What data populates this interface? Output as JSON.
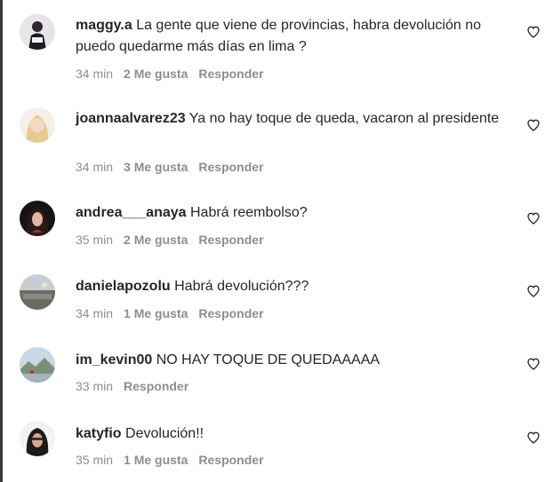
{
  "comments": [
    {
      "user": "maggy.a",
      "text": "La gente que viene de provincias, habra devolución no puedo quedarme más días en lima ?",
      "time": "34 min",
      "likes": "2 Me gusta",
      "reply": "Responder",
      "avatar_icon": "user-avatar"
    },
    {
      "user": "joannaalvarez23",
      "text": "Ya no hay toque de queda, vacaron al presidente",
      "time": "34 min",
      "likes": "3 Me gusta",
      "reply": "Responder",
      "avatar_icon": "user-avatar"
    },
    {
      "user": "andrea___anaya",
      "text": "Habrá reembolso?",
      "time": "35 min",
      "likes": "2 Me gusta",
      "reply": "Responder",
      "avatar_icon": "user-avatar"
    },
    {
      "user": "danielapozolu",
      "text": "Habrá devolución???",
      "time": "34 min",
      "likes": "1 Me gusta",
      "reply": "Responder",
      "avatar_icon": "user-avatar"
    },
    {
      "user": "im_kevin00",
      "text": "NO HAY TOQUE DE QUEDAAAAA",
      "time": "33 min",
      "likes": "",
      "reply": "Responder",
      "avatar_icon": "user-avatar"
    },
    {
      "user": "katyfio",
      "text": "Devolución!!",
      "time": "35 min",
      "likes": "1 Me gusta",
      "reply": "Responder",
      "avatar_icon": "user-avatar"
    }
  ],
  "icons": {
    "like": "heart-outline-icon"
  },
  "colors": {
    "text": "#262626",
    "meta": "#8e8e8e"
  }
}
